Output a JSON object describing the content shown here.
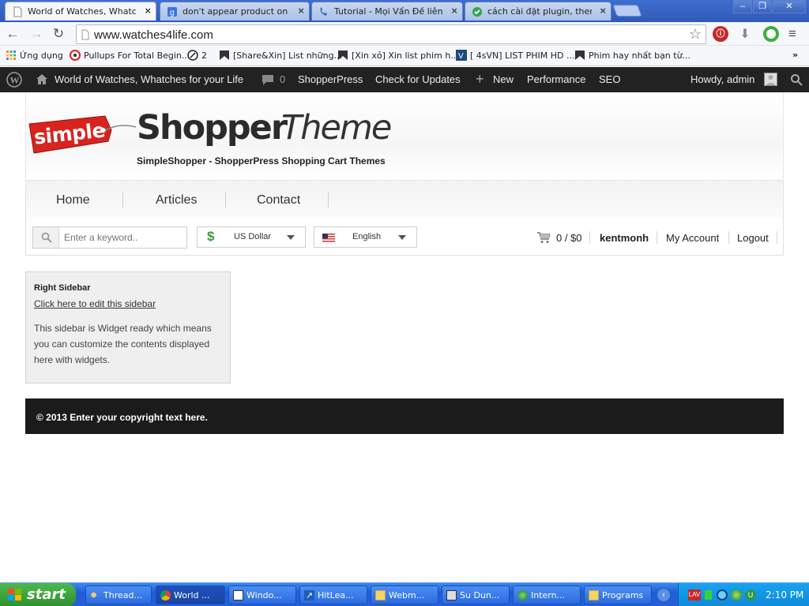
{
  "browser": {
    "tabs": [
      {
        "title": "World of Watches, Whatche",
        "icon": "page-icon",
        "active": true
      },
      {
        "title": "don't appear product on shop",
        "icon": "google-icon",
        "active": false
      },
      {
        "title": "Tutorial - Mọi Vấn Đề liên qua",
        "icon": "phone-icon",
        "active": false
      },
      {
        "title": "cách cài đặt plugin, themes v",
        "icon": "check-icon",
        "active": false
      }
    ],
    "url": "www.watches4life.com",
    "bookmarks": [
      {
        "label": "Ứng dụng",
        "icon": "apps-icon"
      },
      {
        "label": "Pullups For Total Begin...",
        "icon": "pullups-icon"
      },
      {
        "label": "2",
        "icon": "circle-icon"
      },
      {
        "label": "[Share&Xin] List những...",
        "icon": "bm-flag-icon"
      },
      {
        "label": "[Xin xỏ] Xin list phim h...",
        "icon": "bm-flag-icon"
      },
      {
        "label": "[ 4sVN] LIST PHIM HD ...",
        "icon": "v-icon"
      },
      {
        "label": "Phim hay nhất bạn từ...",
        "icon": "bm-flag-icon"
      }
    ],
    "more_label": "»"
  },
  "wpadmin": {
    "site_title": "World of Watches, Whatches for your Life",
    "comments": "0",
    "items": [
      "ShopperPress",
      "Check for Updates",
      "New",
      "Performance",
      "SEO"
    ],
    "howdy": "Howdy, admin"
  },
  "site": {
    "logo_tag": "simple",
    "logo_word1": "Shopper",
    "logo_word2": "Theme",
    "tagline": "SimpleShopper - ShopperPress Shopping Cart Themes",
    "menu": [
      "Home",
      "Articles",
      "Contact"
    ],
    "search_placeholder": "Enter a keyword..",
    "currency": "US Dollar",
    "language": "English",
    "cart": "0 / $0",
    "username": "kentmonh",
    "my_account": "My Account",
    "logout": "Logout",
    "sidebar": {
      "title": "Right Sidebar",
      "link": "Click here to edit this sidebar",
      "text": "This sidebar is Widget ready which means you can customize the contents displayed here with widgets."
    },
    "footer": "© 2013 Enter your copyright text here."
  },
  "taskbar": {
    "start": "start",
    "tasks": [
      {
        "label": "Thread...",
        "icon": "gear-icon",
        "active": false
      },
      {
        "label": "World ...",
        "icon": "chrome-icon",
        "active": true
      },
      {
        "label": "Windo...",
        "icon": "window-icon",
        "active": false
      },
      {
        "label": "HitLea...",
        "icon": "arrow-icon",
        "active": false
      },
      {
        "label": "Webm...",
        "icon": "folder-icon",
        "active": false
      },
      {
        "label": "Su Dun...",
        "icon": "film-icon",
        "active": false
      },
      {
        "label": "Intern...",
        "icon": "globe-icon",
        "active": false
      },
      {
        "label": "Programs",
        "icon": "folder-icon",
        "active": false
      }
    ],
    "clock": "2:10 PM"
  },
  "colors": {
    "wp_bar": "#222222",
    "footer_bg": "#1b1b1b",
    "logo_red": "#d8231f",
    "taskbar_blue": "#2460d8",
    "start_green": "#3a9a3a"
  }
}
